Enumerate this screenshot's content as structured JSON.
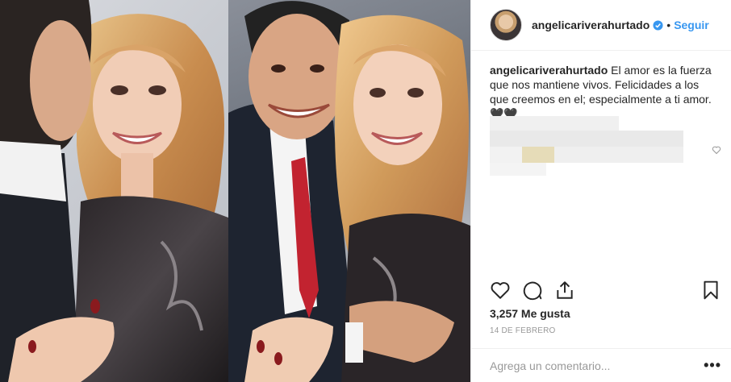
{
  "post": {
    "username": "angelicariverahurtado",
    "follow_label": "Seguir",
    "separator": "•",
    "caption": "El amor es la fuerza que nos mantiene vivos. Felicidades a los que creemos en el; especialmente a ti amor. 🖤🖤",
    "likes": "3,257 Me gusta",
    "date": "14 DE FEBRERO",
    "comment_placeholder": "Agrega un comentario...",
    "more_label": "•••"
  },
  "colors": {
    "link_blue": "#3897f0",
    "verified_blue": "#3897f0",
    "muted": "#999999",
    "border": "#efefef"
  },
  "icons": [
    "verified-badge-icon",
    "heart-icon",
    "comment-icon",
    "share-icon",
    "bookmark-icon",
    "small-heart-icon",
    "more-options-icon"
  ]
}
